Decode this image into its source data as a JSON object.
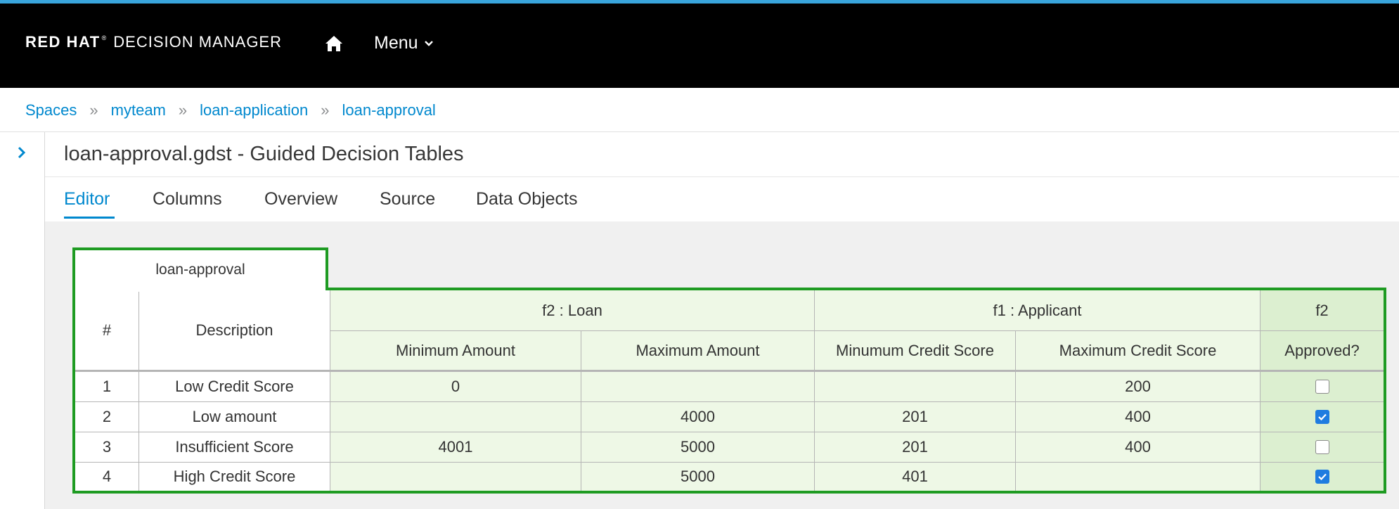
{
  "brand": {
    "bold": "RED HAT",
    "tm": "®",
    "product": "DECISION MANAGER"
  },
  "nav": {
    "menu_label": "Menu"
  },
  "breadcrumb": [
    "Spaces",
    "myteam",
    "loan-application",
    "loan-approval"
  ],
  "breadcrumb_sep": "»",
  "title": "loan-approval.gdst - Guided Decision Tables",
  "tabs": [
    "Editor",
    "Columns",
    "Overview",
    "Source",
    "Data Objects"
  ],
  "active_tab": "Editor",
  "table": {
    "tab_label": "loan-approval",
    "row_number_header": "#",
    "description_header": "Description",
    "groups": [
      "f2 : Loan",
      "f1 : Applicant",
      "f2"
    ],
    "columns": [
      "Minimum Amount",
      "Maximum Amount",
      "Minumum Credit Score",
      "Maximum Credit Score",
      "Approved?"
    ],
    "rows": [
      {
        "num": "1",
        "desc": "Low Credit Score",
        "min_amount": "0",
        "max_amount": "",
        "min_score": "",
        "max_score": "200",
        "approved": false
      },
      {
        "num": "2",
        "desc": "Low amount",
        "min_amount": "",
        "max_amount": "4000",
        "min_score": "201",
        "max_score": "400",
        "approved": true
      },
      {
        "num": "3",
        "desc": "Insufficient Score",
        "min_amount": "4001",
        "max_amount": "5000",
        "min_score": "201",
        "max_score": "400",
        "approved": false
      },
      {
        "num": "4",
        "desc": "High Credit Score",
        "min_amount": "",
        "max_amount": "5000",
        "min_score": "401",
        "max_score": "",
        "approved": true
      }
    ]
  },
  "colors": {
    "accent": "#0088ce",
    "stripe": "#39a5dc",
    "table_border": "#1e9b22",
    "cell_green": "#eef8e6",
    "checkbox_on": "#1f7ce0"
  }
}
